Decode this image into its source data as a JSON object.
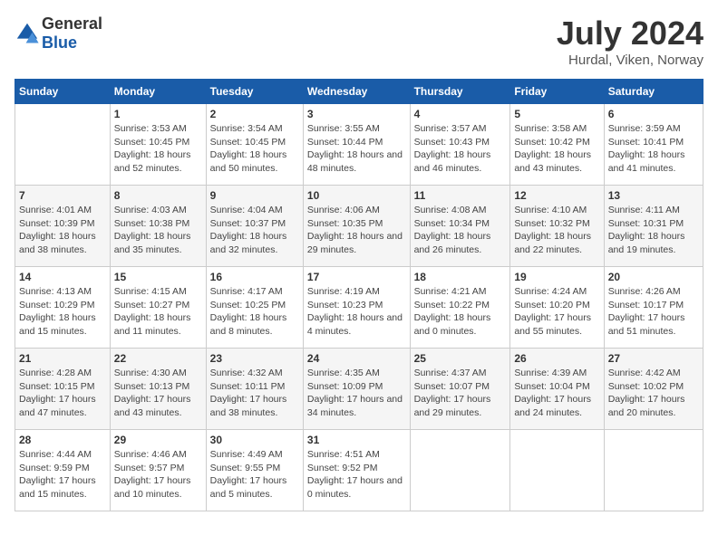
{
  "header": {
    "logo_general": "General",
    "logo_blue": "Blue",
    "month_year": "July 2024",
    "location": "Hurdal, Viken, Norway"
  },
  "days_of_week": [
    "Sunday",
    "Monday",
    "Tuesday",
    "Wednesday",
    "Thursday",
    "Friday",
    "Saturday"
  ],
  "weeks": [
    [
      {
        "day": "",
        "content": ""
      },
      {
        "day": "1",
        "content": "Sunrise: 3:53 AM\nSunset: 10:45 PM\nDaylight: 18 hours and 52 minutes."
      },
      {
        "day": "2",
        "content": "Sunrise: 3:54 AM\nSunset: 10:45 PM\nDaylight: 18 hours and 50 minutes."
      },
      {
        "day": "3",
        "content": "Sunrise: 3:55 AM\nSunset: 10:44 PM\nDaylight: 18 hours and 48 minutes."
      },
      {
        "day": "4",
        "content": "Sunrise: 3:57 AM\nSunset: 10:43 PM\nDaylight: 18 hours and 46 minutes."
      },
      {
        "day": "5",
        "content": "Sunrise: 3:58 AM\nSunset: 10:42 PM\nDaylight: 18 hours and 43 minutes."
      },
      {
        "day": "6",
        "content": "Sunrise: 3:59 AM\nSunset: 10:41 PM\nDaylight: 18 hours and 41 minutes."
      }
    ],
    [
      {
        "day": "7",
        "content": "Sunrise: 4:01 AM\nSunset: 10:39 PM\nDaylight: 18 hours and 38 minutes."
      },
      {
        "day": "8",
        "content": "Sunrise: 4:03 AM\nSunset: 10:38 PM\nDaylight: 18 hours and 35 minutes."
      },
      {
        "day": "9",
        "content": "Sunrise: 4:04 AM\nSunset: 10:37 PM\nDaylight: 18 hours and 32 minutes."
      },
      {
        "day": "10",
        "content": "Sunrise: 4:06 AM\nSunset: 10:35 PM\nDaylight: 18 hours and 29 minutes."
      },
      {
        "day": "11",
        "content": "Sunrise: 4:08 AM\nSunset: 10:34 PM\nDaylight: 18 hours and 26 minutes."
      },
      {
        "day": "12",
        "content": "Sunrise: 4:10 AM\nSunset: 10:32 PM\nDaylight: 18 hours and 22 minutes."
      },
      {
        "day": "13",
        "content": "Sunrise: 4:11 AM\nSunset: 10:31 PM\nDaylight: 18 hours and 19 minutes."
      }
    ],
    [
      {
        "day": "14",
        "content": "Sunrise: 4:13 AM\nSunset: 10:29 PM\nDaylight: 18 hours and 15 minutes."
      },
      {
        "day": "15",
        "content": "Sunrise: 4:15 AM\nSunset: 10:27 PM\nDaylight: 18 hours and 11 minutes."
      },
      {
        "day": "16",
        "content": "Sunrise: 4:17 AM\nSunset: 10:25 PM\nDaylight: 18 hours and 8 minutes."
      },
      {
        "day": "17",
        "content": "Sunrise: 4:19 AM\nSunset: 10:23 PM\nDaylight: 18 hours and 4 minutes."
      },
      {
        "day": "18",
        "content": "Sunrise: 4:21 AM\nSunset: 10:22 PM\nDaylight: 18 hours and 0 minutes."
      },
      {
        "day": "19",
        "content": "Sunrise: 4:24 AM\nSunset: 10:20 PM\nDaylight: 17 hours and 55 minutes."
      },
      {
        "day": "20",
        "content": "Sunrise: 4:26 AM\nSunset: 10:17 PM\nDaylight: 17 hours and 51 minutes."
      }
    ],
    [
      {
        "day": "21",
        "content": "Sunrise: 4:28 AM\nSunset: 10:15 PM\nDaylight: 17 hours and 47 minutes."
      },
      {
        "day": "22",
        "content": "Sunrise: 4:30 AM\nSunset: 10:13 PM\nDaylight: 17 hours and 43 minutes."
      },
      {
        "day": "23",
        "content": "Sunrise: 4:32 AM\nSunset: 10:11 PM\nDaylight: 17 hours and 38 minutes."
      },
      {
        "day": "24",
        "content": "Sunrise: 4:35 AM\nSunset: 10:09 PM\nDaylight: 17 hours and 34 minutes."
      },
      {
        "day": "25",
        "content": "Sunrise: 4:37 AM\nSunset: 10:07 PM\nDaylight: 17 hours and 29 minutes."
      },
      {
        "day": "26",
        "content": "Sunrise: 4:39 AM\nSunset: 10:04 PM\nDaylight: 17 hours and 24 minutes."
      },
      {
        "day": "27",
        "content": "Sunrise: 4:42 AM\nSunset: 10:02 PM\nDaylight: 17 hours and 20 minutes."
      }
    ],
    [
      {
        "day": "28",
        "content": "Sunrise: 4:44 AM\nSunset: 9:59 PM\nDaylight: 17 hours and 15 minutes."
      },
      {
        "day": "29",
        "content": "Sunrise: 4:46 AM\nSunset: 9:57 PM\nDaylight: 17 hours and 10 minutes."
      },
      {
        "day": "30",
        "content": "Sunrise: 4:49 AM\nSunset: 9:55 PM\nDaylight: 17 hours and 5 minutes."
      },
      {
        "day": "31",
        "content": "Sunrise: 4:51 AM\nSunset: 9:52 PM\nDaylight: 17 hours and 0 minutes."
      },
      {
        "day": "",
        "content": ""
      },
      {
        "day": "",
        "content": ""
      },
      {
        "day": "",
        "content": ""
      }
    ]
  ]
}
